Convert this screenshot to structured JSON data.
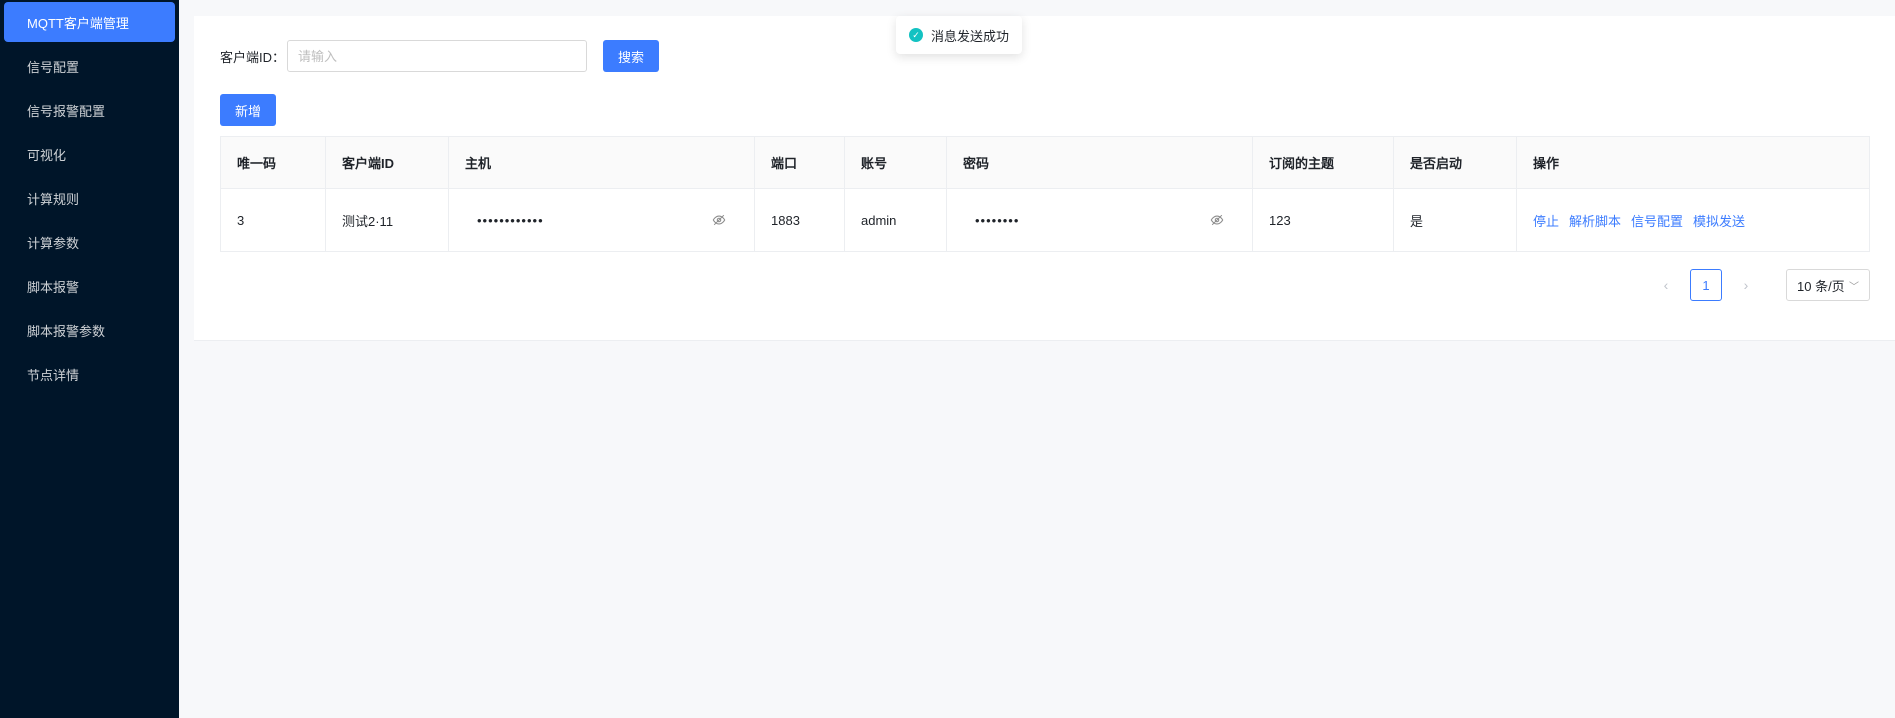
{
  "sidebar": {
    "items": [
      {
        "label": "MQTT客户端管理",
        "active": true
      },
      {
        "label": "信号配置"
      },
      {
        "label": "信号报警配置"
      },
      {
        "label": "可视化"
      },
      {
        "label": "计算规则"
      },
      {
        "label": "计算参数"
      },
      {
        "label": "脚本报警"
      },
      {
        "label": "脚本报警参数"
      },
      {
        "label": "节点详情"
      }
    ]
  },
  "toast": {
    "text": "消息发送成功"
  },
  "search": {
    "label": "客户端ID：",
    "placeholder": "请输入",
    "button": "搜索"
  },
  "toolbar": {
    "add_label": "新增"
  },
  "table": {
    "columns": [
      "唯一码",
      "客户端ID",
      "主机",
      "端口",
      "账号",
      "密码",
      "订阅的主题",
      "是否启动",
      "操作"
    ],
    "rows": [
      {
        "uid": "3",
        "client_id": "测试2·11",
        "host": "••••••••••••",
        "port": "1883",
        "account": "admin",
        "password": "••••••••",
        "topic": "123",
        "enabled": "是",
        "actions": [
          "停止",
          "解析脚本",
          "信号配置",
          "模拟发送"
        ]
      }
    ]
  },
  "pagination": {
    "current_page": "1",
    "page_size": "10 条/页"
  },
  "colors": {
    "accent": "#3c7cff",
    "sidebar_bg": "#001529",
    "success": "#13c2c2"
  }
}
